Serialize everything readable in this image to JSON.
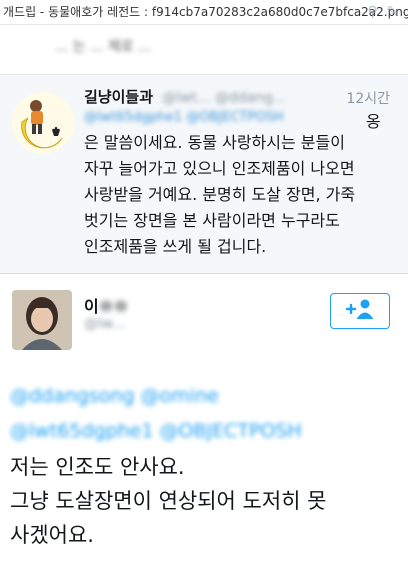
{
  "caption": "개드립 - 동물애호가 레전드 : f914cb7a70283c2a680d0c7e7bfca2a2.png",
  "status_bar": {
    "icons": [
      "search-icon",
      "compose-icon"
    ]
  },
  "previous_tweet": {
    "snippet": "... 는 ... 제로 ..."
  },
  "reply_tweet": {
    "display_name": "길냥이들과",
    "handle": "@lwt... @ddang...",
    "time": "12시간",
    "mentions": "@lwt65dgphe1 @OBJECTPOSH",
    "suffix_char": "옹",
    "body": "은 말씀이세요. 동물 사랑하시는 분들이\n자꾸 늘어가고 있으니 인조제품이 나오면\n사랑받을 거예요. 분명히 도살 장면, 가죽\n벗기는 장면을 본 사람이라면 누구라도\n인조제품을 쓰게 될 겁니다."
  },
  "main_tweet": {
    "name_visible": "이",
    "name_blurred": "ㅇㅇ",
    "handle": "@lw...",
    "follow_icon": "add-user-icon",
    "mention_line_1": "@ddangsong @omine",
    "mention_line_2": "@lwt65dgphe1 @OBJECTPOSH",
    "body": "저는 인조도 안사요.\n그냥 도살장면이 연상되어 도저히 못\n사겠어요."
  },
  "colors": {
    "link_blue": "#1da1f2",
    "muted_gray": "#8899a6",
    "reply_bg": "#f5f8fa",
    "text": "#14171a"
  }
}
